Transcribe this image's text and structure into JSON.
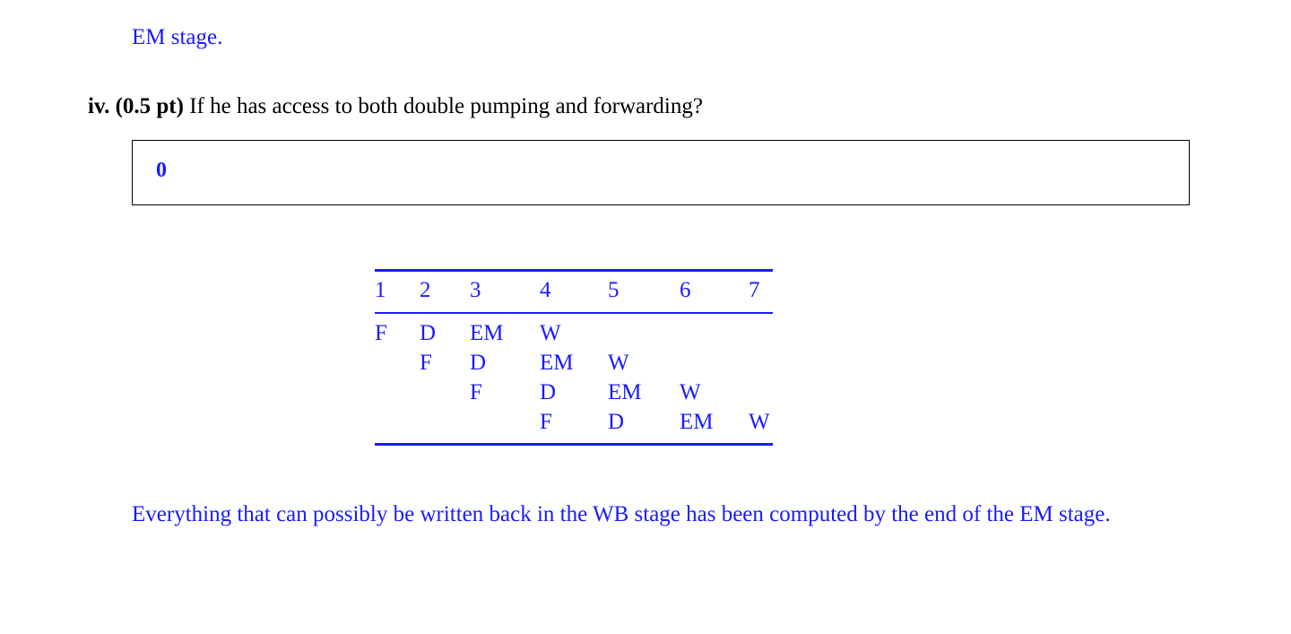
{
  "prev_text": "EM stage.",
  "question": {
    "number": "iv.",
    "points": "(0.5 pt)",
    "text": "If he has access to both double pumping and forwarding?"
  },
  "answer": "0",
  "pipeline_table": {
    "headers": [
      "1",
      "2",
      "3",
      "4",
      "5",
      "6",
      "7"
    ],
    "rows": [
      [
        "F",
        "D",
        "EM",
        "W",
        "",
        "",
        ""
      ],
      [
        "",
        "F",
        "D",
        "EM",
        "W",
        "",
        ""
      ],
      [
        "",
        "",
        "F",
        "D",
        "EM",
        "W",
        ""
      ],
      [
        "",
        "",
        "",
        "F",
        "D",
        "EM",
        "W"
      ]
    ]
  },
  "explanation": "Everything that can possibly be written back in the WB stage has been computed by the end of the EM stage.",
  "colors": {
    "answer_text": "#1a1aff",
    "question_text": "#000000"
  }
}
